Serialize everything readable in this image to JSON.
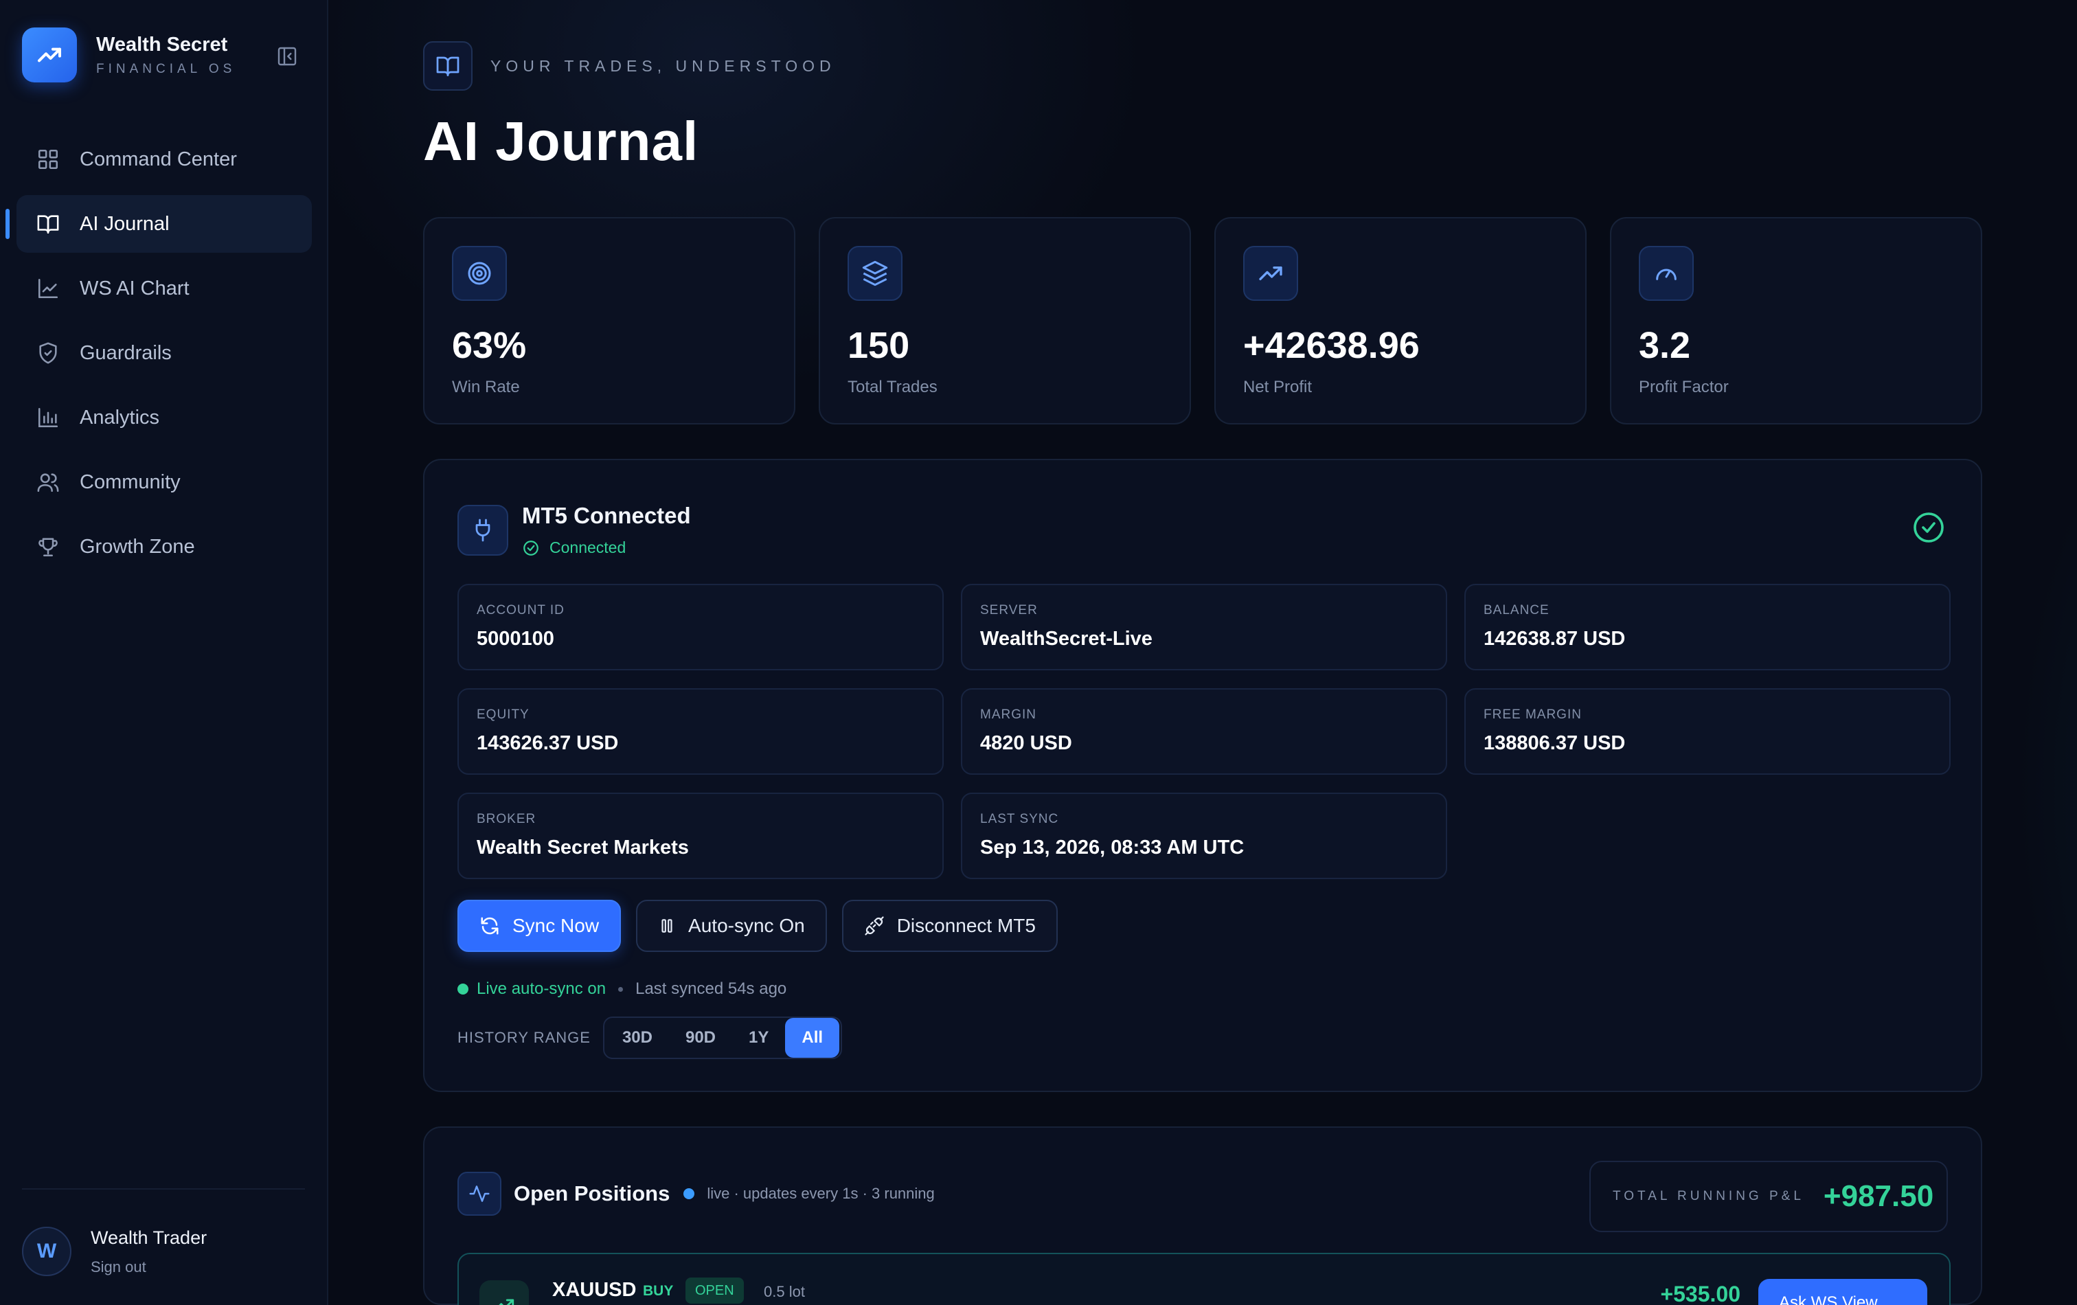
{
  "brand": {
    "name": "Wealth Secret",
    "subtitle": "FINANCIAL OS"
  },
  "nav": [
    {
      "label": "Command Center",
      "icon": "grid-icon"
    },
    {
      "label": "AI Journal",
      "icon": "book-icon",
      "active": true
    },
    {
      "label": "WS AI Chart",
      "icon": "line-chart-icon"
    },
    {
      "label": "Guardrails",
      "icon": "shield-icon"
    },
    {
      "label": "Analytics",
      "icon": "bar-chart-icon"
    },
    {
      "label": "Community",
      "icon": "users-icon"
    },
    {
      "label": "Growth Zone",
      "icon": "trophy-icon"
    }
  ],
  "user": {
    "initial": "W",
    "name": "Wealth Trader",
    "action": "Sign out"
  },
  "header": {
    "eyebrow": "YOUR TRADES, UNDERSTOOD",
    "title": "AI Journal"
  },
  "stats": [
    {
      "value": "63%",
      "label": "Win Rate",
      "icon": "target-icon"
    },
    {
      "value": "150",
      "label": "Total Trades",
      "icon": "layers-icon"
    },
    {
      "value": "+42638.96",
      "label": "Net Profit",
      "icon": "trending-up-icon"
    },
    {
      "value": "3.2",
      "label": "Profit Factor",
      "icon": "gauge-icon"
    }
  ],
  "mt5": {
    "title": "MT5 Connected",
    "status": "Connected",
    "fields": [
      {
        "label": "ACCOUNT ID",
        "value": "5000100"
      },
      {
        "label": "SERVER",
        "value": "WealthSecret-Live"
      },
      {
        "label": "BALANCE",
        "value": "142638.87 USD"
      },
      {
        "label": "EQUITY",
        "value": "143626.37 USD"
      },
      {
        "label": "MARGIN",
        "value": "4820 USD"
      },
      {
        "label": "FREE MARGIN",
        "value": "138806.37 USD"
      },
      {
        "label": "BROKER",
        "value": "Wealth Secret Markets"
      },
      {
        "label": "LAST SYNC",
        "value": "Sep 13, 2026, 08:33 AM UTC"
      }
    ],
    "buttons": {
      "sync": "Sync Now",
      "auto": "Auto-sync On",
      "disconnect": "Disconnect MT5"
    },
    "live": {
      "status": "Live auto-sync on",
      "last": "Last synced 54s ago"
    },
    "history": {
      "label": "HISTORY RANGE",
      "options": [
        "30D",
        "90D",
        "1Y",
        "All"
      ],
      "selected": "All"
    }
  },
  "positions": {
    "title": "Open Positions",
    "meta": "live · updates every 1s · 3 running",
    "total_label": "TOTAL RUNNING P&L",
    "total_value": "+987.50",
    "rows": [
      {
        "symbol": "XAUUSD",
        "side": "BUY",
        "status": "OPEN",
        "lot": "0.5 lot",
        "pnl": "+535.00",
        "action": "Ask WS View"
      }
    ]
  },
  "colors": {
    "accent": "#3b7bff",
    "positive": "#34d399",
    "background": "#070b16",
    "panel": "#0a1021"
  }
}
